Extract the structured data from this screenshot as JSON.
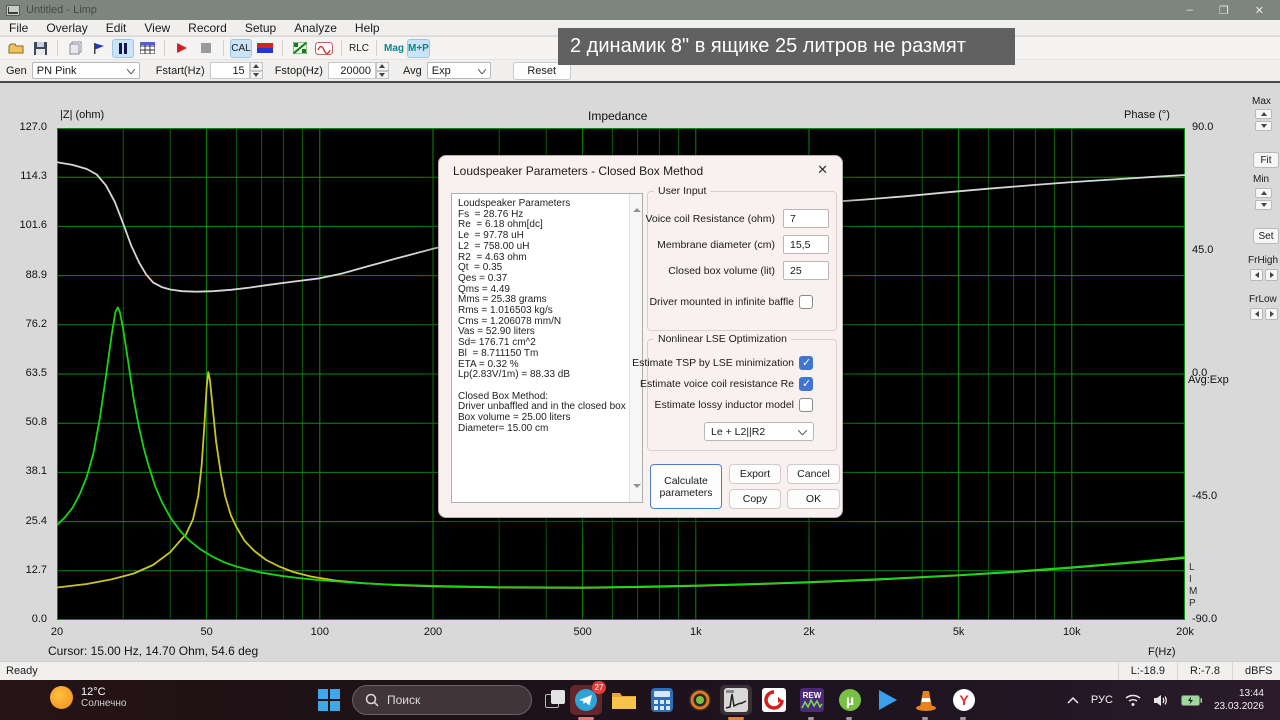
{
  "window": {
    "title": "Untitled - Limp",
    "minimize": "–",
    "restore": "❐",
    "close": "✕"
  },
  "menu": {
    "items": [
      "File",
      "Overlay",
      "Edit",
      "View",
      "Record",
      "Setup",
      "Analyze",
      "Help"
    ]
  },
  "toolbar": {
    "cal_label": "CAL",
    "rlc_label": "RLC",
    "mag_label": "Mag",
    "mp_label": "M+P"
  },
  "controls": {
    "gen_label": "Gen",
    "gen_value": "PN Pink",
    "fstart_label": "Fstart(Hz)",
    "fstart_value": "15",
    "fstop_label": "Fstop(Hz)",
    "fstop_value": "20000",
    "avg_label": "Avg",
    "avg_value": "Exp",
    "reset_label": "Reset"
  },
  "overlay_caption": "2 динамик 8\" в ящике 25 литров не размят",
  "chart_data": {
    "type": "line",
    "title": "Impedance",
    "ylabel_left": "|Z| (ohm)",
    "ylabel_right": "Phase (°)",
    "xlabel": "F(Hz)",
    "x_scale": "log",
    "x_range": [
      20,
      20000
    ],
    "y_left_range": [
      0,
      127
    ],
    "y_right_range": [
      -90,
      90
    ],
    "x_ticks": [
      "20",
      "50",
      "100",
      "200",
      "500",
      "1k",
      "2k",
      "5k",
      "10k",
      "20k"
    ],
    "x_tick_values": [
      20,
      50,
      100,
      200,
      500,
      1000,
      2000,
      5000,
      10000,
      20000
    ],
    "y_left_tick_labels": [
      "127.0",
      "114.3",
      "101.6",
      "88.9",
      "76.2",
      "63.5",
      "50.8",
      "38.1",
      "25.4",
      "12.7",
      "0.0"
    ],
    "y_left_tick_values": [
      127,
      114.3,
      101.6,
      88.9,
      76.2,
      63.5,
      50.8,
      38.1,
      25.4,
      12.7,
      0
    ],
    "y_right_tick_labels": [
      "90.0",
      "45.0",
      "0.0",
      "-45.0",
      "-90.0"
    ],
    "y_right_tick_values": [
      90,
      45,
      0,
      -45,
      -90
    ],
    "grid_x_minor": [
      30,
      40,
      60,
      70,
      80,
      90,
      300,
      400,
      600,
      700,
      800,
      900,
      3000,
      4000,
      6000,
      7000,
      8000,
      9000
    ],
    "grid_color_minor": "#0a620a",
    "grid_color_major": "#0e8a0e",
    "legend": "off",
    "series": [
      {
        "name": "phase",
        "color": "#d6d6d6",
        "axis": "right",
        "points": [
          [
            20,
            77.5
          ],
          [
            22,
            76.5
          ],
          [
            24,
            75
          ],
          [
            25.5,
            73
          ],
          [
            27,
            69
          ],
          [
            28.5,
            63
          ],
          [
            30,
            55
          ],
          [
            31.5,
            47
          ],
          [
            33,
            41
          ],
          [
            34.5,
            36.5
          ],
          [
            36,
            33.5
          ],
          [
            38,
            31.8
          ],
          [
            40,
            30.9
          ],
          [
            43,
            30.3
          ],
          [
            47,
            30.1
          ],
          [
            52,
            30.3
          ],
          [
            58,
            30.8
          ],
          [
            65,
            31.6
          ],
          [
            75,
            32.8
          ],
          [
            85,
            33.8
          ],
          [
            100,
            35
          ],
          [
            115,
            36.8
          ],
          [
            135,
            39.5
          ],
          [
            160,
            42.3
          ],
          [
            200,
            45.8
          ],
          [
            250,
            48.8
          ],
          [
            320,
            51.5
          ],
          [
            420,
            54
          ],
          [
            550,
            56
          ],
          [
            700,
            57.6
          ],
          [
            900,
            59
          ],
          [
            1200,
            60.4
          ],
          [
            1600,
            61.6
          ],
          [
            2100,
            62.6
          ],
          [
            2800,
            63.8
          ],
          [
            3600,
            65
          ],
          [
            4700,
            66.5
          ],
          [
            6000,
            67.8
          ],
          [
            8000,
            69.2
          ],
          [
            10000,
            70.2
          ],
          [
            13000,
            71.2
          ],
          [
            16000,
            72
          ],
          [
            20000,
            72.8
          ]
        ]
      },
      {
        "name": "impedance-closed-box",
        "color": "#c9c71f",
        "axis": "left",
        "points": [
          [
            20,
            8.4
          ],
          [
            24,
            9.3
          ],
          [
            28,
            10.5
          ],
          [
            32,
            12
          ],
          [
            36,
            14.2
          ],
          [
            40,
            17.5
          ],
          [
            43,
            21
          ],
          [
            44,
            22
          ],
          [
            46,
            26
          ],
          [
            47.5,
            32
          ],
          [
            48.5,
            40
          ],
          [
            49.3,
            50
          ],
          [
            50,
            60
          ],
          [
            50.5,
            64
          ],
          [
            51,
            62
          ],
          [
            52,
            54
          ],
          [
            53,
            46
          ],
          [
            54.5,
            38
          ],
          [
            56,
            32
          ],
          [
            58,
            27
          ],
          [
            60,
            24
          ],
          [
            63,
            20.5
          ],
          [
            67,
            17.8
          ],
          [
            72,
            15.5
          ],
          [
            78,
            13.8
          ],
          [
            85,
            12.4
          ],
          [
            95,
            11.2
          ],
          [
            110,
            10.2
          ],
          [
            130,
            9.5
          ],
          [
            160,
            9
          ],
          [
            200,
            8.7
          ],
          [
            300,
            8.4
          ],
          [
            500,
            8.3
          ],
          [
            700,
            8.5
          ],
          [
            1000,
            8.8
          ],
          [
            1500,
            9.3
          ],
          [
            2000,
            9.7
          ],
          [
            3000,
            10.4
          ],
          [
            5000,
            11.5
          ],
          [
            7000,
            12.4
          ],
          [
            10000,
            13.5
          ],
          [
            14000,
            14.7
          ],
          [
            20000,
            16
          ]
        ]
      },
      {
        "name": "impedance-free-air",
        "color": "#17d417",
        "axis": "left",
        "points": [
          [
            20,
            24.5
          ],
          [
            21,
            26.5
          ],
          [
            22,
            29
          ],
          [
            23,
            32.5
          ],
          [
            24,
            37
          ],
          [
            25,
            43
          ],
          [
            26,
            52
          ],
          [
            27,
            63
          ],
          [
            28,
            74
          ],
          [
            28.6,
            79.5
          ],
          [
            29,
            80.7
          ],
          [
            29.4,
            79.5
          ],
          [
            30,
            75
          ],
          [
            31,
            66
          ],
          [
            32,
            57
          ],
          [
            33,
            50
          ],
          [
            34,
            44.5
          ],
          [
            35,
            40
          ],
          [
            36.5,
            34.5
          ],
          [
            38,
            30.5
          ],
          [
            40,
            26.5
          ],
          [
            42.5,
            23
          ],
          [
            45,
            20.5
          ],
          [
            48,
            18.3
          ],
          [
            52,
            16.3
          ],
          [
            56,
            14.8
          ],
          [
            60,
            13.8
          ],
          [
            65,
            12.9
          ],
          [
            70,
            12.2
          ],
          [
            80,
            11.3
          ],
          [
            90,
            10.7
          ],
          [
            100,
            10.3
          ],
          [
            120,
            9.7
          ],
          [
            150,
            9.2
          ],
          [
            200,
            8.8
          ],
          [
            300,
            8.5
          ],
          [
            500,
            8.4
          ],
          [
            700,
            8.6
          ],
          [
            1000,
            8.9
          ],
          [
            1500,
            9.4
          ],
          [
            2000,
            9.8
          ],
          [
            3000,
            10.5
          ],
          [
            5000,
            11.6
          ],
          [
            7000,
            12.5
          ],
          [
            10000,
            13.6
          ],
          [
            14000,
            14.8
          ],
          [
            20000,
            16.2
          ]
        ]
      }
    ]
  },
  "right_panel": {
    "max_label": "Max",
    "fit_label": "Fit",
    "min_label": "Min",
    "set_label": "Set",
    "frhigh_label": "FrHigh",
    "frlow_label": "FrLow",
    "avg_mode": "Avg:Exp",
    "limp_vertical": "L\nI\nM\nP"
  },
  "cursor_status": "Cursor: 15.00 Hz, 14.70 Ohm, 54.6 deg",
  "status_bar": {
    "ready": "Ready",
    "left_level": "L:-18.9",
    "right_level": "R:-7.8",
    "unit": "dBFS"
  },
  "dialog": {
    "title": "Loudspeaker Parameters - Closed Box Method",
    "close": "✕",
    "params_lines": [
      "Loudspeaker Parameters",
      "Fs  = 28.76 Hz",
      "Re  = 6.18 ohm[dc]",
      "Le  = 97.78 uH",
      "L2  = 758.00 uH",
      "R2  = 4.63 ohm",
      "Qt  = 0.35",
      "Qes = 0.37",
      "Qms = 4.49",
      "Mms = 25.38 grams",
      "Rms = 1.016503 kg/s",
      "Cms = 1.206078 mm/N",
      "Vas = 52.90 liters",
      "Sd= 176.71 cm^2",
      "Bl  = 8.711150 Tm",
      "ETA = 0.32 %",
      "Lp(2.83V/1m) = 88.33 dB",
      "",
      "Closed Box Method:",
      "Driver unbaffled and in the closed box",
      "Box volume = 25.00 liters",
      "Diameter= 15.00 cm"
    ],
    "user_input": {
      "title": "User Input",
      "rows": [
        {
          "label": "Voice coil Resistance (ohm)",
          "value": "7"
        },
        {
          "label": "Membrane diameter (cm)",
          "value": "15,5"
        },
        {
          "label": "Closed box volume (lit)",
          "value": "25"
        }
      ],
      "baffle": {
        "label": "Driver mounted in infinite baffle",
        "checked": false
      }
    },
    "lse": {
      "title": "Nonlinear LSE Optimization",
      "checks": [
        {
          "label": "Estimate TSP by LSE minimization",
          "checked": true
        },
        {
          "label": "Estimate voice coil resistance Re",
          "checked": true
        },
        {
          "label": "Estimate lossy inductor model",
          "checked": false
        }
      ],
      "model_value": "Le + L2||R2"
    },
    "buttons": {
      "calculate": "Calculate parameters",
      "export": "Export",
      "cancel": "Cancel",
      "copy": "Copy",
      "ok": "OK"
    }
  },
  "taskbar": {
    "weather_temp": "12°C",
    "weather_condition": "Солнечно",
    "search_placeholder": "Поиск",
    "telegram_badge": "27",
    "tray_lang": "РУС",
    "tray_time": "13:44",
    "tray_date": "23.03.2026"
  }
}
